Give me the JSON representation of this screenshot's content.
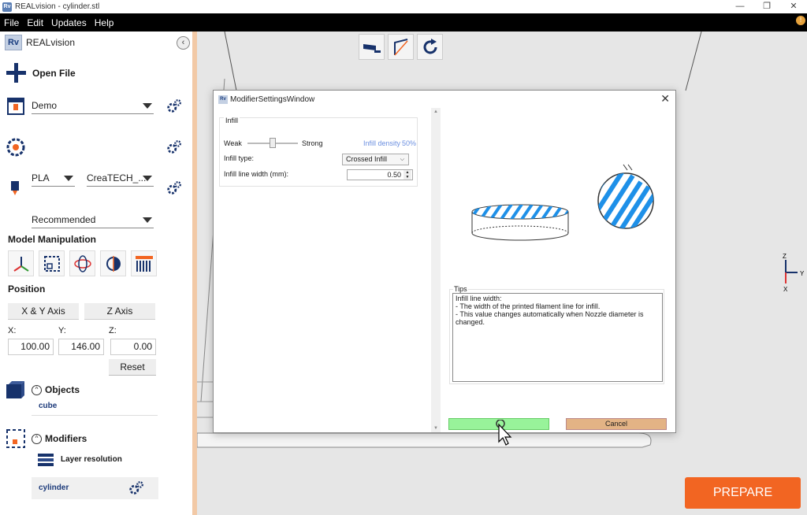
{
  "window": {
    "title": "REALvision - cylinder.stl",
    "logo": "Rv",
    "controls": [
      "—",
      "❐",
      "✕"
    ]
  },
  "menu": {
    "items": [
      "File",
      "Edit",
      "Updates",
      "Help"
    ],
    "warn": "!"
  },
  "sidebar": {
    "logo": "Rv",
    "app_name": "REALvision",
    "collapse": "‹",
    "open_file": "Open File",
    "printer": "Demo",
    "material": "PLA",
    "material_brand": "CreaTECH_...",
    "profile": "Recommended",
    "model_manipulation": "Model Manipulation",
    "position": "Position",
    "xy_axis": "X & Y Axis",
    "z_axis": "Z Axis",
    "x_label": "X:",
    "y_label": "Y:",
    "z_label": "Z:",
    "x_value": "100.00",
    "y_value": "146.00",
    "z_value": "0.00",
    "reset": "Reset",
    "objects_title": "Objects",
    "objects": [
      "cube"
    ],
    "modifiers_title": "Modifiers",
    "layer_resolution": "Layer resolution",
    "modifier_item": "cylinder",
    "toggle_glyph": "^"
  },
  "dialog": {
    "logo": "Rv",
    "title": "ModifierSettingsWindow",
    "close": "✕",
    "infill_group": "Infill",
    "weak": "Weak",
    "strong": "Strong",
    "density_label": "Infill density",
    "density_value": "50%",
    "infill_level": 0.5,
    "infill_type_label": "Infill type:",
    "infill_type_value": "Crossed Infill",
    "line_width_label": "Infill line width (mm):",
    "line_width_value": "0.50",
    "tips_legend": "Tips",
    "tips_lines": [
      "Infill line width:",
      "- The width of the printed filament line for infill.",
      "- This value changes automatically when Nozzle diameter is",
      "changed."
    ],
    "ok_label": "",
    "cancel_label": "Cancel"
  },
  "viewport": {
    "axis_z": "Z",
    "axis_y": "Y",
    "axis_x": "X",
    "prepare": "PREPARE"
  },
  "colors": {
    "accent": "#f26522",
    "navy": "#17326b",
    "infill_blue": "#1e90e8"
  }
}
